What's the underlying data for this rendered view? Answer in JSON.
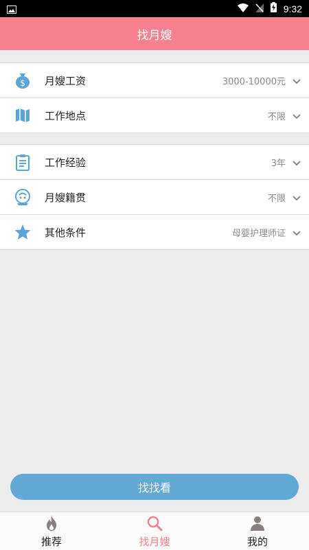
{
  "status_bar": {
    "time": "9:32"
  },
  "app_bar": {
    "title": "找月嫂"
  },
  "criteria_groups": [
    {
      "rows": [
        {
          "label": "月嫂工资",
          "value": "3000-10000元",
          "icon": "money-bag-icon"
        },
        {
          "label": "工作地点",
          "value": "不限",
          "icon": "map-icon"
        }
      ]
    },
    {
      "rows": [
        {
          "label": "工作经验",
          "value": "3年",
          "icon": "clipboard-icon"
        },
        {
          "label": "月嫂籍贯",
          "value": "不限",
          "icon": "hometown-icon"
        },
        {
          "label": "其他条件",
          "value": "母婴护理师证",
          "icon": "star-icon"
        }
      ]
    }
  ],
  "actions": {
    "search_label": "找找看"
  },
  "tab_bar": {
    "tabs": [
      {
        "label": "推荐",
        "icon": "flame-icon",
        "active": false
      },
      {
        "label": "找月嫂",
        "icon": "search-icon",
        "active": true
      },
      {
        "label": "我的",
        "icon": "person-icon",
        "active": false
      }
    ]
  },
  "colors": {
    "primary": "#f7808f",
    "button": "#62a9d6",
    "icon_blue": "#5aa5d5",
    "tab_icon_gray": "#8a8080"
  }
}
